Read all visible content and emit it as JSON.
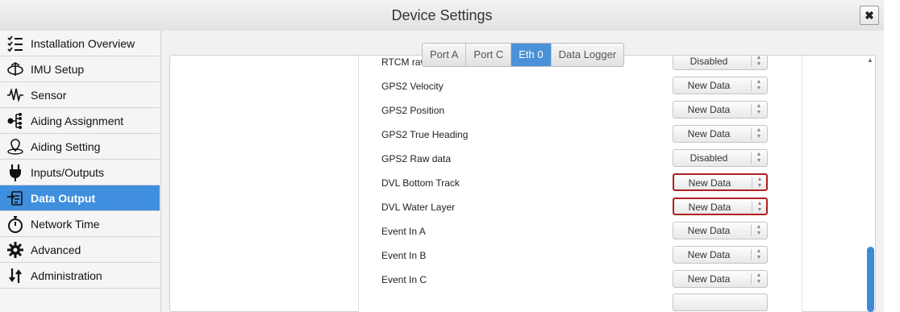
{
  "window": {
    "title": "Device Settings",
    "close_label": "✖"
  },
  "sidebar": {
    "items": [
      {
        "label": "Installation Overview",
        "icon": "checklist-icon"
      },
      {
        "label": "IMU Setup",
        "icon": "imu-icon"
      },
      {
        "label": "Sensor",
        "icon": "waveform-icon"
      },
      {
        "label": "Aiding Assignment",
        "icon": "tree-icon"
      },
      {
        "label": "Aiding Setting",
        "icon": "map-pin-icon"
      },
      {
        "label": "Inputs/Outputs",
        "icon": "plug-icon"
      },
      {
        "label": "Data Output",
        "icon": "export-icon",
        "active": true
      },
      {
        "label": "Network Time",
        "icon": "stopwatch-icon"
      },
      {
        "label": "Advanced",
        "icon": "gear-icon"
      },
      {
        "label": "Administration",
        "icon": "admin-icon"
      }
    ]
  },
  "tabs": [
    {
      "label": "Port A"
    },
    {
      "label": "Port C"
    },
    {
      "label": "Eth 0",
      "active": true
    },
    {
      "label": "Data Logger"
    }
  ],
  "rows": [
    {
      "label": "RTCM raw data",
      "value": "Disabled"
    },
    {
      "label": "GPS2 Velocity",
      "value": "New Data"
    },
    {
      "label": "GPS2 Position",
      "value": "New Data"
    },
    {
      "label": "GPS2 True Heading",
      "value": "New Data"
    },
    {
      "label": "GPS2 Raw data",
      "value": "Disabled"
    },
    {
      "label": "DVL Bottom Track",
      "value": "New Data",
      "highlighted": true
    },
    {
      "label": "DVL Water Layer",
      "value": "New Data",
      "highlighted": true
    },
    {
      "label": "Event In A",
      "value": "New Data"
    },
    {
      "label": "Event In B",
      "value": "New Data"
    },
    {
      "label": "Event In C",
      "value": "New Data"
    }
  ],
  "colors": {
    "accent": "#3f8fde",
    "highlight_border": "#b02020"
  }
}
